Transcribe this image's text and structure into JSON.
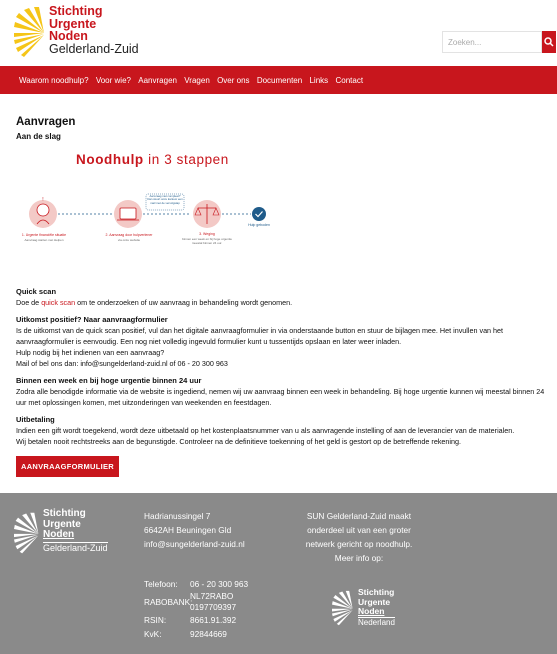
{
  "header": {
    "logo": {
      "line1": "Stichting",
      "line2": "Urgente",
      "line3": "Noden",
      "line4": "Gelderland-Zuid"
    },
    "search": {
      "placeholder": "Zoeken..."
    }
  },
  "nav": {
    "items": [
      {
        "label": "Waarom noodhulp?"
      },
      {
        "label": "Voor wie?"
      },
      {
        "label": "Aanvragen"
      },
      {
        "label": "Vragen"
      },
      {
        "label": "Over ons"
      },
      {
        "label": "Documenten"
      },
      {
        "label": "Links"
      },
      {
        "label": "Contact"
      }
    ]
  },
  "main": {
    "title": "Aanvragen",
    "subtitle": "Aan de slag",
    "infographic": {
      "title_bold": "Noodhulp",
      "title_rest": " in 3 stappen",
      "step1_label": "1. Urgente financiële situatie",
      "step1_sub": "Aanvraag starten met Helpen",
      "step2_label": "2. Aanvraag door hulpverlener",
      "step2_sub": "via onze website",
      "step3_label": "3. Weging",
      "step3_sub": "binnen een week en bij hoge urgentie meestal binnen 24 uur.",
      "callout": "Aanvraag niet compleet? Dan stuurt onze kantoor een mail met de vervolgstap",
      "done": "Hulp geboden"
    },
    "sections": {
      "quickscan_title": "Quick scan",
      "quickscan_pre": "Doe de ",
      "quickscan_link": "quick scan",
      "quickscan_post": " om te onderzoeken of uw aanvraag in behandeling wordt genomen.",
      "positive_title": "Uitkomst positief? Naar aanvraagformulier",
      "positive_text": "Is de uitkomst van de quick scan positief, vul dan het digitale aanvraagformulier in via onderstaande button en stuur de bijlagen mee. Het invullen van het aanvraagformulier is eenvoudig. Een nog niet volledig ingevuld formulier kunt u tussentijds opslaan en later weer inladen.",
      "positive_help": "Hulp nodig bij het indienen van een aanvraag?",
      "positive_contact": "Mail of bel ons dan: info@sungelderland-zuid.nl of 06 - 20 300 963",
      "week_title": "Binnen een week en bij hoge urgentie binnen 24 uur",
      "week_text": "Zodra alle benodigde informatie via de website is ingediend, nemen wij uw aanvraag binnen een week in behandeling. Bij hoge urgentie kunnen wij meestal binnen 24 uur met oplossingen komen, met uitzonderingen van weekenden en feestdagen.",
      "pay_title": "Uitbetaling",
      "pay_text1": "Indien een gift wordt toegekend, wordt deze uitbetaald op het kostenplaatsnummer van u als aanvragende instelling of aan de leverancier van de materialen.",
      "pay_text2": "Wij betalen nooit rechtstreeks aan de begunstigde. Controleer na de definitieve toekenning of het geld is gestort op de betreffende rekening."
    },
    "cta_label": "AANVRAAGFORMULIER"
  },
  "footer": {
    "logo": {
      "line1": "Stichting",
      "line2": "Urgente",
      "line3": "Noden",
      "line4": "Gelderland-Zuid"
    },
    "address": {
      "street": "Hadrianussingel 7",
      "city": "6642AH Beuningen Gld",
      "email": "info@sungelderland-zuid.nl"
    },
    "contact": {
      "phone_key": "Telefoon:",
      "phone_val": "06 - 20 300 963",
      "bank_key": "RABOBANK:",
      "bank_val1": "NL72RABO",
      "bank_val2": "0197709397",
      "rsin_key": "RSIN:",
      "rsin_val": "8661.91.392",
      "kvk_key": "KvK:",
      "kvk_val": "92844669"
    },
    "network": {
      "line1": "SUN Gelderland-Zuid maakt",
      "line2": "onderdeel uit van een groter",
      "line3": "netwerk gericht op noodhulp.",
      "line4": "Meer info op:"
    },
    "logo2": {
      "line1": "Stichting",
      "line2": "Urgente",
      "line3": "Noden",
      "line4": "Nederland"
    }
  },
  "colors": {
    "brand_red": "#c8161d",
    "brand_yellow": "#f5c518",
    "footer_grey": "#8a8a8a"
  }
}
